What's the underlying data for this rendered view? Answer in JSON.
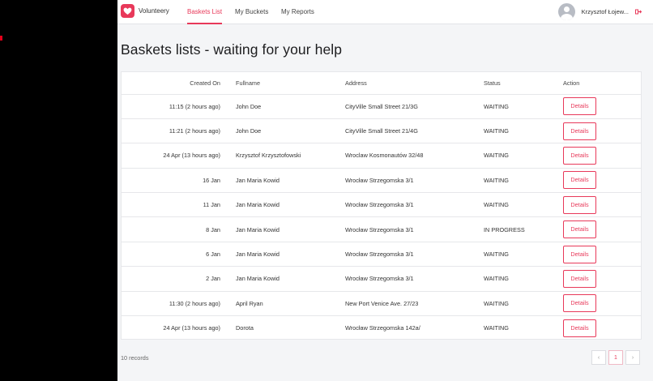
{
  "app": {
    "name": "Volunteery"
  },
  "nav": {
    "links": [
      {
        "label": "Baskets List",
        "active": true
      },
      {
        "label": "My Buckets",
        "active": false
      },
      {
        "label": "My Reports",
        "active": false
      }
    ]
  },
  "user": {
    "name": "Krzysztof Łojew..."
  },
  "page": {
    "title": "Baskets lists - waiting for your help"
  },
  "table": {
    "headers": {
      "created_on": "Created On",
      "fullname": "Fullname",
      "address": "Address",
      "status": "Status",
      "action": "Action"
    },
    "rows": [
      {
        "created_on": "11:15 (2 hours ago)",
        "fullname": "John Doe",
        "address": "CityVille Small Street 21/3G",
        "status": "WAITING",
        "action": "Details"
      },
      {
        "created_on": "11:21 (2 hours ago)",
        "fullname": "John Doe",
        "address": "CityVille Small Street 21/4G",
        "status": "WAITING",
        "action": "Details"
      },
      {
        "created_on": "24 Apr (13 hours ago)",
        "fullname": "Krzysztof Krzysztofowski",
        "address": "Wroclaw Kosmonautów 32/48",
        "status": "WAITING",
        "action": "Details"
      },
      {
        "created_on": "16 Jan",
        "fullname": "Jan Maria Kowid",
        "address": "Wrocław Strzegomska 3/1",
        "status": "WAITING",
        "action": "Details"
      },
      {
        "created_on": "11 Jan",
        "fullname": "Jan Maria Kowid",
        "address": "Wrocław Strzegomska 3/1",
        "status": "WAITING",
        "action": "Details"
      },
      {
        "created_on": "8 Jan",
        "fullname": "Jan Maria Kowid",
        "address": "Wrocław Strzegomska 3/1",
        "status": "IN PROGRESS",
        "action": "Details"
      },
      {
        "created_on": "6 Jan",
        "fullname": "Jan Maria Kowid",
        "address": "Wrocław Strzegomska 3/1",
        "status": "WAITING",
        "action": "Details"
      },
      {
        "created_on": "2 Jan",
        "fullname": "Jan Maria Kowid",
        "address": "Wrocław Strzegomska 3/1",
        "status": "WAITING",
        "action": "Details"
      },
      {
        "created_on": "11:30 (2 hours ago)",
        "fullname": "April Ryan",
        "address": "New Port Venice Ave. 27/23",
        "status": "WAITING",
        "action": "Details"
      },
      {
        "created_on": "24 Apr (13 hours ago)",
        "fullname": "Dorota",
        "address": "Wrocław Strzegomska 142a/",
        "status": "WAITING",
        "action": "Details"
      }
    ]
  },
  "footer": {
    "records": "10 records",
    "pagination": {
      "prev": "‹",
      "current": "1",
      "next": "›"
    }
  },
  "colors": {
    "accent": "#e8395a",
    "background": "#f4f5f7",
    "border": "#e6e7ea"
  },
  "icons": {
    "logo": "heart-logo-icon",
    "avatar": "user-avatar-icon",
    "logout": "logout-icon",
    "prev": "chevron-left-icon",
    "next": "chevron-right-icon"
  }
}
